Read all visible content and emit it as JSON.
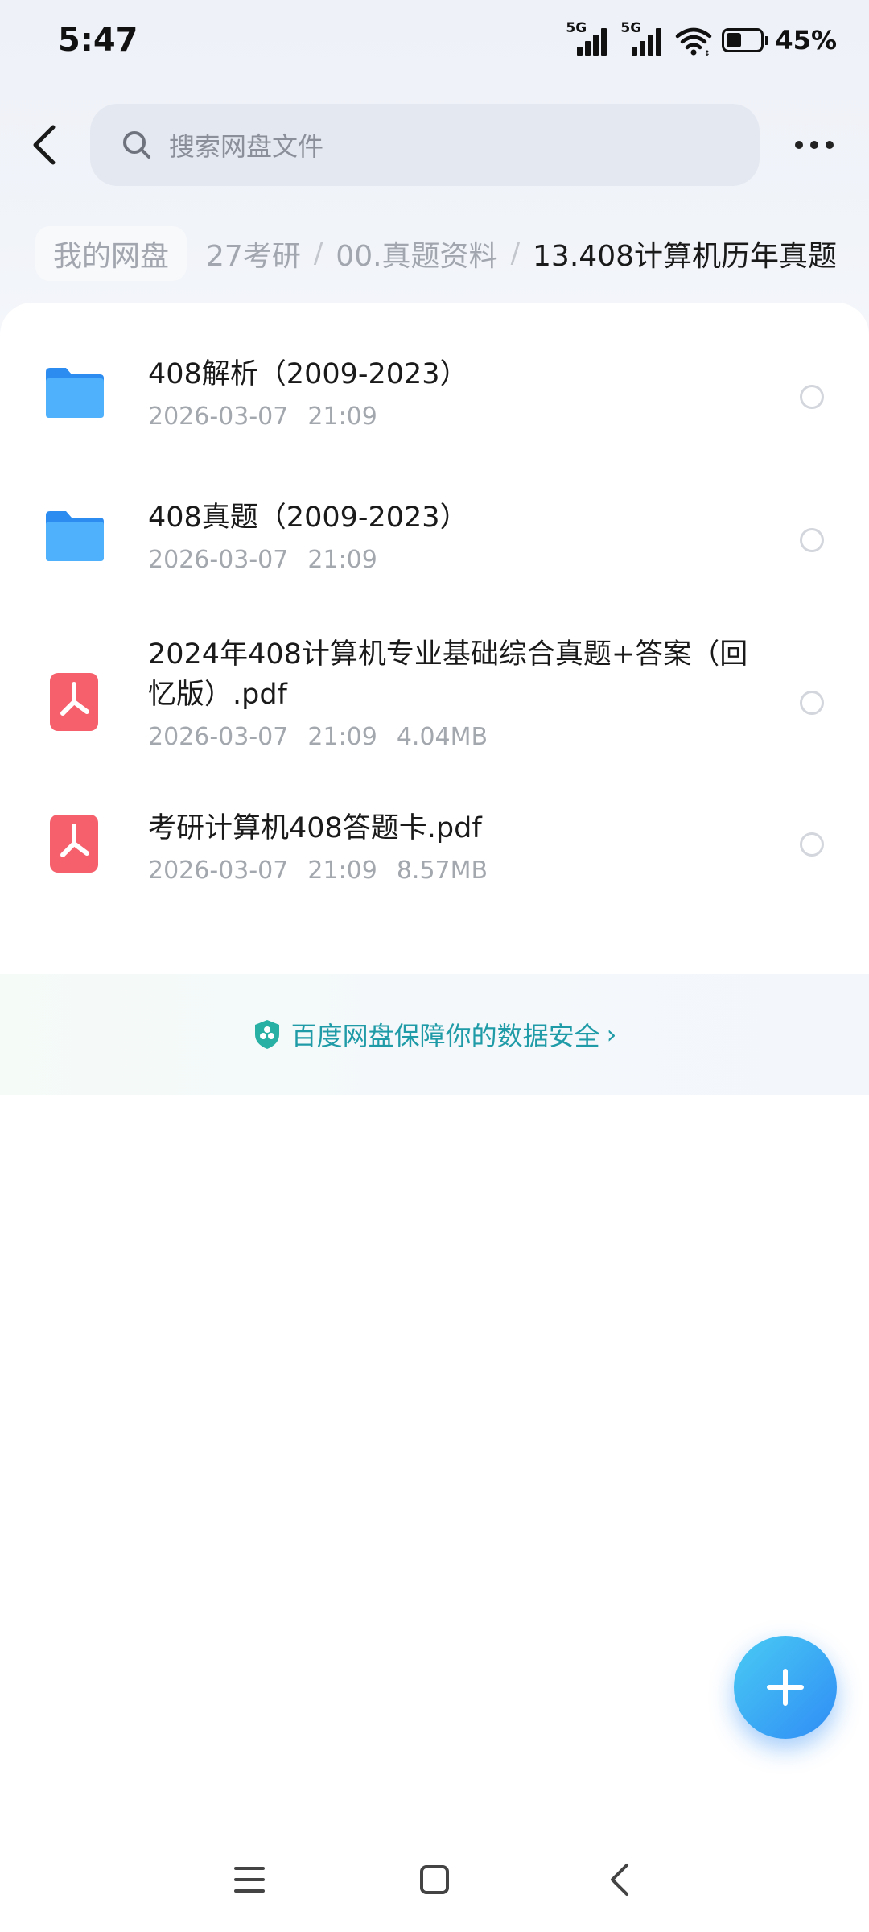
{
  "status_bar": {
    "time": "5:47",
    "signal_1_label": "5G",
    "signal_2_label": "5G",
    "battery_percent": "45%",
    "battery_level": 0.45
  },
  "header": {
    "search_placeholder": "搜索网盘文件"
  },
  "breadcrumb": {
    "root": "我的网盘",
    "items": [
      "27考研",
      "00.真题资料"
    ],
    "current": "13.408计算机历年真题",
    "separator": "/"
  },
  "files": [
    {
      "name": "408解析（2009-2023）",
      "date": "2026-03-07",
      "time": "21:09",
      "size": "",
      "type": "folder"
    },
    {
      "name": "408真题（2009-2023）",
      "date": "2026-03-07",
      "time": "21:09",
      "size": "",
      "type": "folder"
    },
    {
      "name": "2024年408计算机专业基础综合真题+答案（回忆版）.pdf",
      "date": "2026-03-07",
      "time": "21:09",
      "size": "4.04MB",
      "type": "pdf"
    },
    {
      "name": "考研计算机408答题卡.pdf",
      "date": "2026-03-07",
      "time": "21:09",
      "size": "8.57MB",
      "type": "pdf"
    }
  ],
  "security_banner": {
    "text": "百度网盘保障你的数据安全"
  },
  "colors": {
    "accent": "#2f8cf5",
    "folder": "#42a5f8",
    "pdf": "#f5606c",
    "security": "#1f9ba7"
  },
  "icons": {
    "back": "back-arrow-icon",
    "search": "search-icon",
    "more": "more-dots-icon",
    "folder": "folder-icon",
    "pdf": "pdf-icon",
    "shield": "shield-icon",
    "add": "plus-icon",
    "nav_menu": "menu-icon",
    "nav_home": "home-square-icon",
    "nav_back": "back-chevron-icon"
  }
}
